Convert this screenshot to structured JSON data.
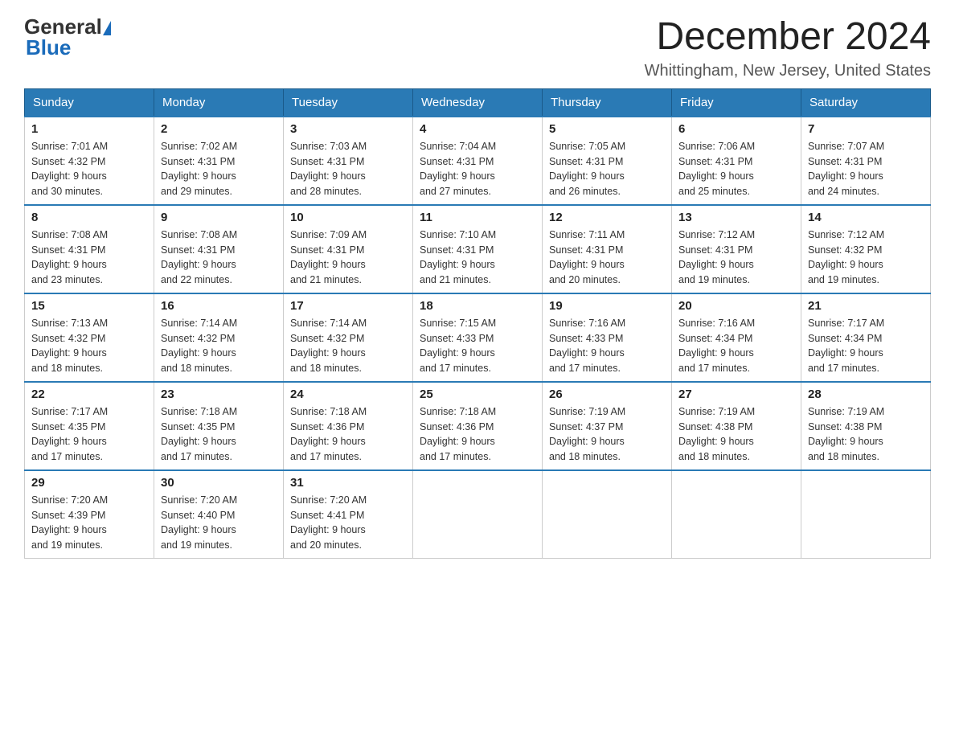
{
  "logo": {
    "general": "General",
    "blue": "Blue"
  },
  "title": "December 2024",
  "subtitle": "Whittingham, New Jersey, United States",
  "weekdays": [
    "Sunday",
    "Monday",
    "Tuesday",
    "Wednesday",
    "Thursday",
    "Friday",
    "Saturday"
  ],
  "weeks": [
    [
      {
        "day": "1",
        "sunrise": "7:01 AM",
        "sunset": "4:32 PM",
        "daylight": "9 hours and 30 minutes."
      },
      {
        "day": "2",
        "sunrise": "7:02 AM",
        "sunset": "4:31 PM",
        "daylight": "9 hours and 29 minutes."
      },
      {
        "day": "3",
        "sunrise": "7:03 AM",
        "sunset": "4:31 PM",
        "daylight": "9 hours and 28 minutes."
      },
      {
        "day": "4",
        "sunrise": "7:04 AM",
        "sunset": "4:31 PM",
        "daylight": "9 hours and 27 minutes."
      },
      {
        "day": "5",
        "sunrise": "7:05 AM",
        "sunset": "4:31 PM",
        "daylight": "9 hours and 26 minutes."
      },
      {
        "day": "6",
        "sunrise": "7:06 AM",
        "sunset": "4:31 PM",
        "daylight": "9 hours and 25 minutes."
      },
      {
        "day": "7",
        "sunrise": "7:07 AM",
        "sunset": "4:31 PM",
        "daylight": "9 hours and 24 minutes."
      }
    ],
    [
      {
        "day": "8",
        "sunrise": "7:08 AM",
        "sunset": "4:31 PM",
        "daylight": "9 hours and 23 minutes."
      },
      {
        "day": "9",
        "sunrise": "7:08 AM",
        "sunset": "4:31 PM",
        "daylight": "9 hours and 22 minutes."
      },
      {
        "day": "10",
        "sunrise": "7:09 AM",
        "sunset": "4:31 PM",
        "daylight": "9 hours and 21 minutes."
      },
      {
        "day": "11",
        "sunrise": "7:10 AM",
        "sunset": "4:31 PM",
        "daylight": "9 hours and 21 minutes."
      },
      {
        "day": "12",
        "sunrise": "7:11 AM",
        "sunset": "4:31 PM",
        "daylight": "9 hours and 20 minutes."
      },
      {
        "day": "13",
        "sunrise": "7:12 AM",
        "sunset": "4:31 PM",
        "daylight": "9 hours and 19 minutes."
      },
      {
        "day": "14",
        "sunrise": "7:12 AM",
        "sunset": "4:32 PM",
        "daylight": "9 hours and 19 minutes."
      }
    ],
    [
      {
        "day": "15",
        "sunrise": "7:13 AM",
        "sunset": "4:32 PM",
        "daylight": "9 hours and 18 minutes."
      },
      {
        "day": "16",
        "sunrise": "7:14 AM",
        "sunset": "4:32 PM",
        "daylight": "9 hours and 18 minutes."
      },
      {
        "day": "17",
        "sunrise": "7:14 AM",
        "sunset": "4:32 PM",
        "daylight": "9 hours and 18 minutes."
      },
      {
        "day": "18",
        "sunrise": "7:15 AM",
        "sunset": "4:33 PM",
        "daylight": "9 hours and 17 minutes."
      },
      {
        "day": "19",
        "sunrise": "7:16 AM",
        "sunset": "4:33 PM",
        "daylight": "9 hours and 17 minutes."
      },
      {
        "day": "20",
        "sunrise": "7:16 AM",
        "sunset": "4:34 PM",
        "daylight": "9 hours and 17 minutes."
      },
      {
        "day": "21",
        "sunrise": "7:17 AM",
        "sunset": "4:34 PM",
        "daylight": "9 hours and 17 minutes."
      }
    ],
    [
      {
        "day": "22",
        "sunrise": "7:17 AM",
        "sunset": "4:35 PM",
        "daylight": "9 hours and 17 minutes."
      },
      {
        "day": "23",
        "sunrise": "7:18 AM",
        "sunset": "4:35 PM",
        "daylight": "9 hours and 17 minutes."
      },
      {
        "day": "24",
        "sunrise": "7:18 AM",
        "sunset": "4:36 PM",
        "daylight": "9 hours and 17 minutes."
      },
      {
        "day": "25",
        "sunrise": "7:18 AM",
        "sunset": "4:36 PM",
        "daylight": "9 hours and 17 minutes."
      },
      {
        "day": "26",
        "sunrise": "7:19 AM",
        "sunset": "4:37 PM",
        "daylight": "9 hours and 18 minutes."
      },
      {
        "day": "27",
        "sunrise": "7:19 AM",
        "sunset": "4:38 PM",
        "daylight": "9 hours and 18 minutes."
      },
      {
        "day": "28",
        "sunrise": "7:19 AM",
        "sunset": "4:38 PM",
        "daylight": "9 hours and 18 minutes."
      }
    ],
    [
      {
        "day": "29",
        "sunrise": "7:20 AM",
        "sunset": "4:39 PM",
        "daylight": "9 hours and 19 minutes."
      },
      {
        "day": "30",
        "sunrise": "7:20 AM",
        "sunset": "4:40 PM",
        "daylight": "9 hours and 19 minutes."
      },
      {
        "day": "31",
        "sunrise": "7:20 AM",
        "sunset": "4:41 PM",
        "daylight": "9 hours and 20 minutes."
      },
      null,
      null,
      null,
      null
    ]
  ],
  "labels": {
    "sunrise": "Sunrise:",
    "sunset": "Sunset:",
    "daylight": "Daylight:"
  }
}
